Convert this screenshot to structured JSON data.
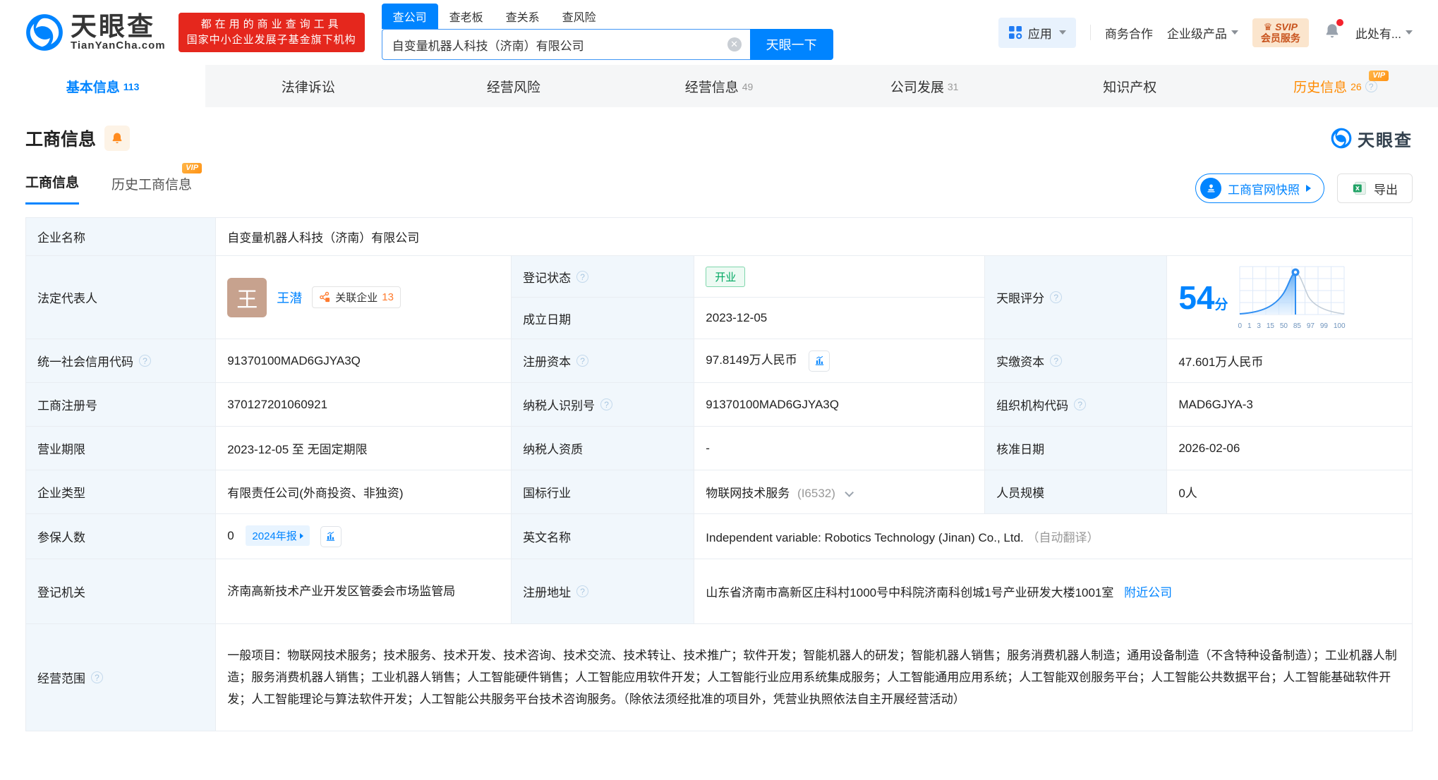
{
  "brand": {
    "name": "天眼查",
    "domain": "TianYanCha.com",
    "slogan_line1": "都在用的商业查询工具",
    "slogan_line2": "国家中小企业发展子基金旗下机构"
  },
  "search": {
    "tabs": [
      {
        "label": "查公司"
      },
      {
        "label": "查老板"
      },
      {
        "label": "查关系"
      },
      {
        "label": "查风险"
      }
    ],
    "value": "自变量机器人科技（济南）有限公司",
    "button": "天眼一下"
  },
  "topnav": {
    "apps": "应用",
    "cooperation": "商务合作",
    "enterprise": "企业级产品",
    "svip_line1": "SVIP",
    "svip_line2": "会员服务",
    "more": "此处有..."
  },
  "nav_tabs": [
    {
      "label": "基本信息",
      "count": "113"
    },
    {
      "label": "法律诉讼",
      "count": ""
    },
    {
      "label": "经营风险",
      "count": ""
    },
    {
      "label": "经营信息",
      "count": "49"
    },
    {
      "label": "公司发展",
      "count": "31"
    },
    {
      "label": "知识产权",
      "count": ""
    },
    {
      "label": "历史信息",
      "count": "26"
    }
  ],
  "section": {
    "title": "工商信息",
    "vip": "VIP",
    "subtab_active": "工商信息",
    "subtab_history": "历史工商信息",
    "snapshot": "工商官网快照",
    "export": "导出"
  },
  "score": {
    "label": "天眼评分",
    "value": "54",
    "unit": "分",
    "chart_data": {
      "type": "area",
      "title": "天眼评分分布曲线",
      "x_ticks": [
        "0",
        "1",
        "3",
        "15",
        "50",
        "85",
        "97",
        "99",
        "100"
      ],
      "marker_value": 54,
      "marker_tick_position": "between 50 and 85",
      "shape": "bell curve, filled blue left of marker, gray line right of marker"
    }
  },
  "fields": {
    "company_name": {
      "label": "企业名称",
      "value": "自变量机器人科技（济南）有限公司"
    },
    "legal_rep": {
      "label": "法定代表人",
      "avatar": "王",
      "name": "王潜",
      "related_label": "关联企业",
      "related_count": "13"
    },
    "reg_status": {
      "label": "登记状态",
      "value": "开业"
    },
    "establish_date": {
      "label": "成立日期",
      "value": "2023-12-05"
    },
    "credit_code": {
      "label": "统一社会信用代码",
      "value": "91370100MAD6GJYA3Q"
    },
    "reg_capital": {
      "label": "注册资本",
      "value": "97.8149万人民币"
    },
    "paid_capital": {
      "label": "实缴资本",
      "value": "47.601万人民币"
    },
    "reg_number": {
      "label": "工商注册号",
      "value": "370127201060921"
    },
    "taxpayer_id": {
      "label": "纳税人识别号",
      "value": "91370100MAD6GJYA3Q"
    },
    "org_code": {
      "label": "组织机构代码",
      "value": "MAD6GJYA-3"
    },
    "business_term": {
      "label": "营业期限",
      "value": "2023-12-05 至 无固定期限"
    },
    "taxpayer_quality": {
      "label": "纳税人资质",
      "value": "-"
    },
    "approval_date": {
      "label": "核准日期",
      "value": "2026-02-06"
    },
    "company_type": {
      "label": "企业类型",
      "value": "有限责任公司(外商投资、非独资)"
    },
    "industry": {
      "label": "国标行业",
      "value": "物联网技术服务",
      "code": "(I6532)"
    },
    "staff_size": {
      "label": "人员规模",
      "value": "0人"
    },
    "insured": {
      "label": "参保人数",
      "value": "0",
      "report_badge": "2024年报"
    },
    "english_name": {
      "label": "英文名称",
      "value": "Independent variable: Robotics Technology (Jinan) Co., Ltd.",
      "note": "（自动翻译）"
    },
    "reg_authority": {
      "label": "登记机关",
      "value": "济南高新技术产业开发区管委会市场监管局"
    },
    "reg_address": {
      "label": "注册地址",
      "value": "山东省济南市高新区庄科村1000号中科院济南科创城1号产业研发大楼1001室",
      "nearby": "附近公司"
    },
    "business_scope": {
      "label": "经营范围",
      "value": "一般项目：物联网技术服务；技术服务、技术开发、技术咨询、技术交流、技术转让、技术推广；软件开发；智能机器人的研发；智能机器人销售；服务消费机器人制造；通用设备制造（不含特种设备制造）；工业机器人制造；服务消费机器人销售；工业机器人销售；人工智能硬件销售；人工智能应用软件开发；人工智能行业应用系统集成服务；人工智能通用应用系统；人工智能双创服务平台；人工智能公共数据平台；人工智能基础软件开发；人工智能理论与算法软件开发；人工智能公共服务平台技术咨询服务。（除依法须经批准的项目外，凭营业执照依法自主开展经营活动）"
    }
  },
  "colors": {
    "primary": "#0084ff",
    "orange": "#ff8a00",
    "green": "#00a862",
    "banner_red": "#e5271d"
  }
}
